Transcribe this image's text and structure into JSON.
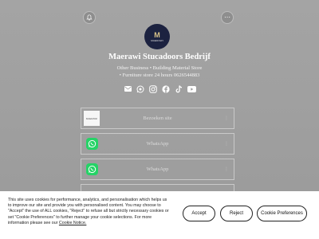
{
  "header": {
    "left_icon": "bell-icon",
    "right_icon": "more-icon",
    "right_glyph": "⋯"
  },
  "profile": {
    "logo_mark": "M",
    "logo_wordmark": "MAERAWI",
    "name": "Maerawi Stucadoors Bedrijf",
    "description_line1": "Other Business • Building Material Store",
    "description_line2": "• Furniture store 24 hours 0626544883"
  },
  "socials": [
    {
      "icon": "email-icon"
    },
    {
      "icon": "whatsapp-icon"
    },
    {
      "icon": "instagram-icon"
    },
    {
      "icon": "facebook-icon"
    },
    {
      "icon": "tiktok-icon"
    },
    {
      "icon": "youtube-icon"
    }
  ],
  "links": [
    {
      "label": "Bezoeken site",
      "thumb_text": "MAERAWI"
    },
    {
      "label": "WhatsApp"
    },
    {
      "label": "WhatsApp"
    },
    {
      "label": ""
    }
  ],
  "cookie": {
    "text": "This site uses cookies for performance, analytics, and personalisation which helps us to improve our site and provide you with personalised content. You may choose to \"Accept\" the use of ALL cookies, \"Reject\" to refuse all but strictly necessary cookies or set \"Cookie Preferences\" to further manage your cookie selections. For more information please see our",
    "notice_link": "Cookie Notice.",
    "accept_label": "Accept",
    "reject_label": "Reject",
    "preferences_label": "Cookie Preferences"
  }
}
